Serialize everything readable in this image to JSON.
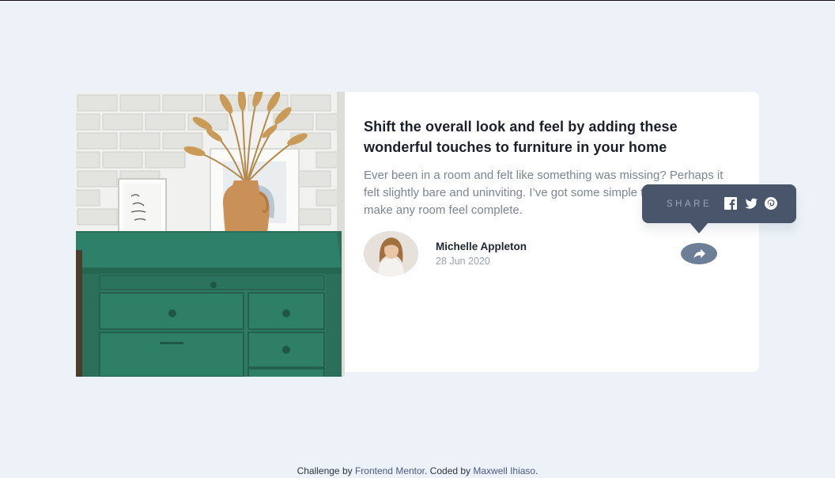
{
  "article": {
    "title": "Shift the overall look and feel by adding these wonderful touches to furniture in your home",
    "description": "Ever been in a room and felt like something was missing? Perhaps it felt slightly bare and uninviting. I’ve got some simple tips to help you make any room feel complete.",
    "image_icon": "drawers-photo"
  },
  "author": {
    "name": "Michelle Appleton",
    "date": "28 Jun 2020",
    "avatar_icon": "avatar-photo"
  },
  "share": {
    "label": "SHARE",
    "icons": [
      "facebook-icon",
      "twitter-icon",
      "pinterest-icon"
    ],
    "button_icon": "share-icon"
  },
  "footer": {
    "prefix": "Challenge by ",
    "challenge_link": "Frontend Mentor",
    "middle": ". Coded by ",
    "author_link": "Maxwell Ihiaso",
    "suffix": "."
  },
  "colors": {
    "background": "#ecf2f8",
    "card": "#ffffff",
    "popover": "#48556a",
    "share_button": "#6d7f97",
    "dresser": "#2e7a63"
  }
}
